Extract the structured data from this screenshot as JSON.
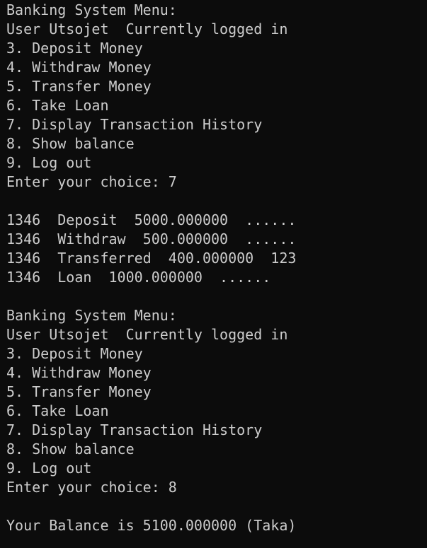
{
  "terminal": {
    "lines": [
      "Banking System Menu:",
      "User Utsojet  Currently logged in",
      "3. Deposit Money",
      "4. Withdraw Money",
      "5. Transfer Money",
      "6. Take Loan",
      "7. Display Transaction History",
      "8. Show balance",
      "9. Log out",
      "Enter your choice: 7",
      "",
      "1346  Deposit  5000.000000  ......",
      "1346  Withdraw  500.000000  ......",
      "1346  Transferred  400.000000  123",
      "1346  Loan  1000.000000  ......",
      "",
      "Banking System Menu:",
      "User Utsojet  Currently logged in",
      "3. Deposit Money",
      "4. Withdraw Money",
      "5. Transfer Money",
      "6. Take Loan",
      "7. Display Transaction History",
      "8. Show balance",
      "9. Log out",
      "Enter your choice: 8",
      "",
      "Your Balance is 5100.000000 (Taka)"
    ]
  }
}
